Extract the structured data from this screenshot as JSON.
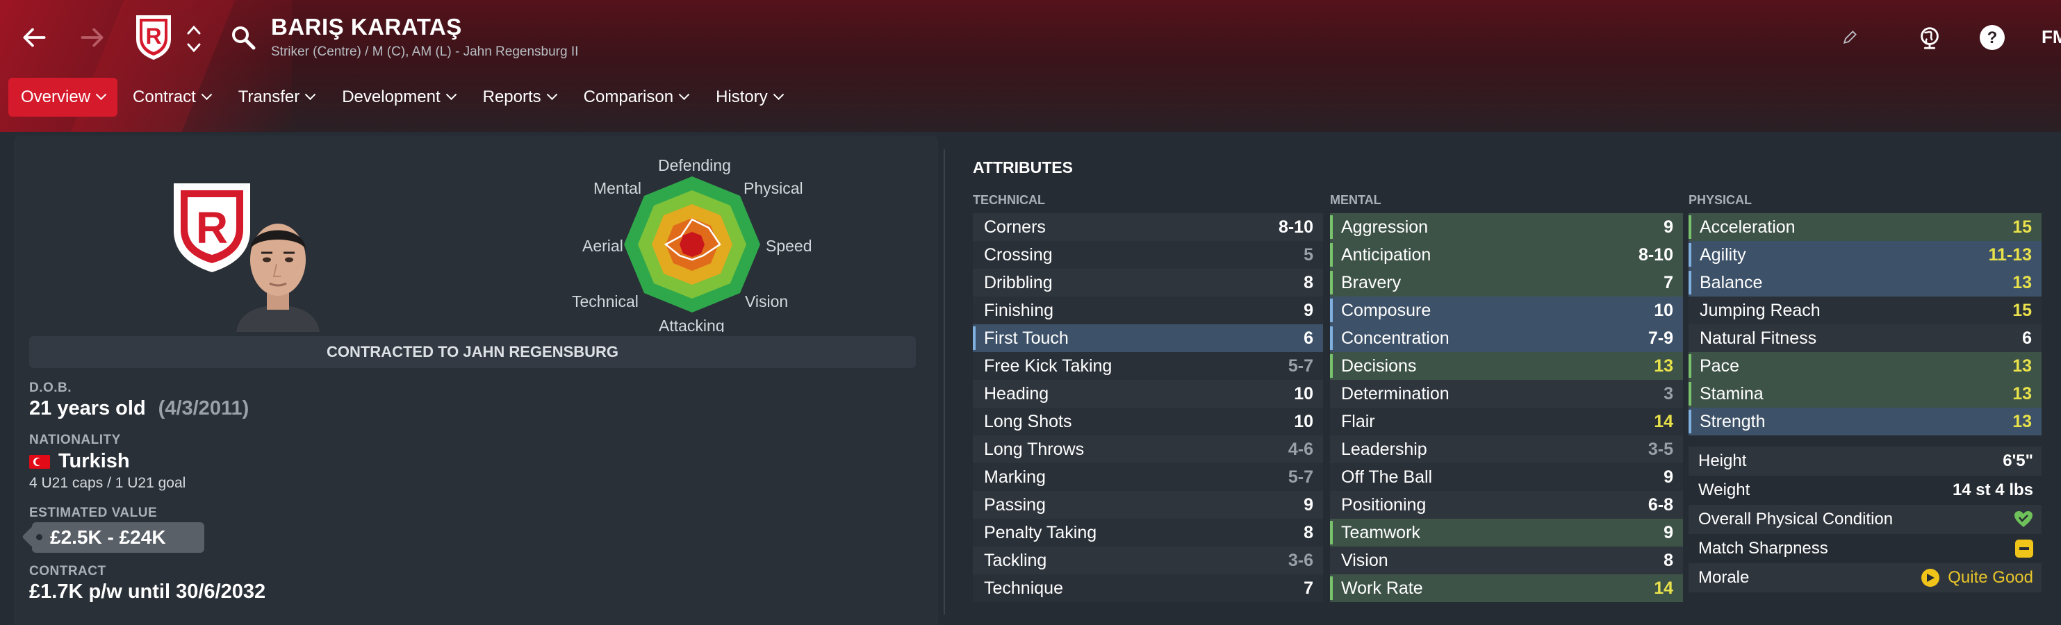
{
  "header": {
    "player_name": "BARIŞ KARATAŞ",
    "subtitle": "Striker (Centre) / M (C), AM (L) - Jahn Regensburg II",
    "logo": "FM",
    "icons": [
      "back-arrow-icon",
      "forward-arrow-icon",
      "club-crest-icon",
      "up-down-chevron-icon",
      "search-icon",
      "pencil-icon",
      "globe-icon",
      "help-icon"
    ],
    "accent_color": "#d51a2c"
  },
  "tabs": [
    {
      "label": "Overview",
      "active": true
    },
    {
      "label": "Contract",
      "active": false
    },
    {
      "label": "Transfer",
      "active": false
    },
    {
      "label": "Development",
      "active": false
    },
    {
      "label": "Reports",
      "active": false
    },
    {
      "label": "Comparison",
      "active": false
    },
    {
      "label": "History",
      "active": false
    }
  ],
  "profile": {
    "contract_banner": "CONTRACTED TO JAHN REGENSBURG",
    "dob_label": "D.O.B.",
    "age": "21 years old",
    "dob": "(4/3/2011)",
    "nationality_label": "NATIONALITY",
    "nationality": "Turkish",
    "caps": "4 U21 caps / 1 U21 goal",
    "value_label": "ESTIMATED VALUE",
    "value": "£2.5K - £24K",
    "contract_label": "CONTRACT",
    "contract": "£1.7K p/w until 30/6/2032"
  },
  "radar": {
    "labels": {
      "defending": "Defending",
      "physical": "Physical",
      "speed": "Speed",
      "vision": "Vision",
      "attacking": "Attacking",
      "technical": "Technical",
      "aerial": "Aerial",
      "mental": "Mental"
    }
  },
  "attributes": {
    "title": "ATTRIBUTES",
    "technical_title": "TECHNICAL",
    "mental_title": "MENTAL",
    "physical_title": "PHYSICAL",
    "technical": [
      {
        "name": "Corners",
        "value": "8-10",
        "tone": "white",
        "hl": ""
      },
      {
        "name": "Crossing",
        "value": "5",
        "tone": "grey",
        "hl": ""
      },
      {
        "name": "Dribbling",
        "value": "8",
        "tone": "white",
        "hl": ""
      },
      {
        "name": "Finishing",
        "value": "9",
        "tone": "white",
        "hl": ""
      },
      {
        "name": "First Touch",
        "value": "6",
        "tone": "white",
        "hl": "blue"
      },
      {
        "name": "Free Kick Taking",
        "value": "5-7",
        "tone": "grey",
        "hl": ""
      },
      {
        "name": "Heading",
        "value": "10",
        "tone": "white",
        "hl": ""
      },
      {
        "name": "Long Shots",
        "value": "10",
        "tone": "white",
        "hl": ""
      },
      {
        "name": "Long Throws",
        "value": "4-6",
        "tone": "grey",
        "hl": ""
      },
      {
        "name": "Marking",
        "value": "5-7",
        "tone": "grey",
        "hl": ""
      },
      {
        "name": "Passing",
        "value": "9",
        "tone": "white",
        "hl": ""
      },
      {
        "name": "Penalty Taking",
        "value": "8",
        "tone": "white",
        "hl": ""
      },
      {
        "name": "Tackling",
        "value": "3-6",
        "tone": "grey",
        "hl": ""
      },
      {
        "name": "Technique",
        "value": "7",
        "tone": "white",
        "hl": ""
      }
    ],
    "mental": [
      {
        "name": "Aggression",
        "value": "9",
        "tone": "white",
        "hl": "green"
      },
      {
        "name": "Anticipation",
        "value": "8-10",
        "tone": "white",
        "hl": "green"
      },
      {
        "name": "Bravery",
        "value": "7",
        "tone": "white",
        "hl": "green"
      },
      {
        "name": "Composure",
        "value": "10",
        "tone": "white",
        "hl": "blue"
      },
      {
        "name": "Concentration",
        "value": "7-9",
        "tone": "white",
        "hl": "blue"
      },
      {
        "name": "Decisions",
        "value": "13",
        "tone": "yellow",
        "hl": "green"
      },
      {
        "name": "Determination",
        "value": "3",
        "tone": "grey",
        "hl": ""
      },
      {
        "name": "Flair",
        "value": "14",
        "tone": "yellow",
        "hl": ""
      },
      {
        "name": "Leadership",
        "value": "3-5",
        "tone": "grey",
        "hl": ""
      },
      {
        "name": "Off The Ball",
        "value": "9",
        "tone": "white",
        "hl": ""
      },
      {
        "name": "Positioning",
        "value": "6-8",
        "tone": "white",
        "hl": ""
      },
      {
        "name": "Teamwork",
        "value": "9",
        "tone": "white",
        "hl": "green"
      },
      {
        "name": "Vision",
        "value": "8",
        "tone": "white",
        "hl": ""
      },
      {
        "name": "Work Rate",
        "value": "14",
        "tone": "yellow",
        "hl": "green"
      }
    ],
    "physical": [
      {
        "name": "Acceleration",
        "value": "15",
        "tone": "yellow",
        "hl": "green"
      },
      {
        "name": "Agility",
        "value": "11-13",
        "tone": "yellow",
        "hl": "blue"
      },
      {
        "name": "Balance",
        "value": "13",
        "tone": "yellow",
        "hl": "blue"
      },
      {
        "name": "Jumping Reach",
        "value": "15",
        "tone": "yellow",
        "hl": ""
      },
      {
        "name": "Natural Fitness",
        "value": "6",
        "tone": "white",
        "hl": ""
      },
      {
        "name": "Pace",
        "value": "13",
        "tone": "yellow",
        "hl": "green"
      },
      {
        "name": "Stamina",
        "value": "13",
        "tone": "yellow",
        "hl": "green"
      },
      {
        "name": "Strength",
        "value": "13",
        "tone": "yellow",
        "hl": "blue"
      }
    ],
    "info": {
      "height_label": "Height",
      "height": "6'5\"",
      "weight_label": "Weight",
      "weight": "14 st 4 lbs",
      "condition_label": "Overall Physical Condition",
      "sharpness_label": "Match Sharpness",
      "morale_label": "Morale",
      "morale": "Quite Good"
    }
  }
}
